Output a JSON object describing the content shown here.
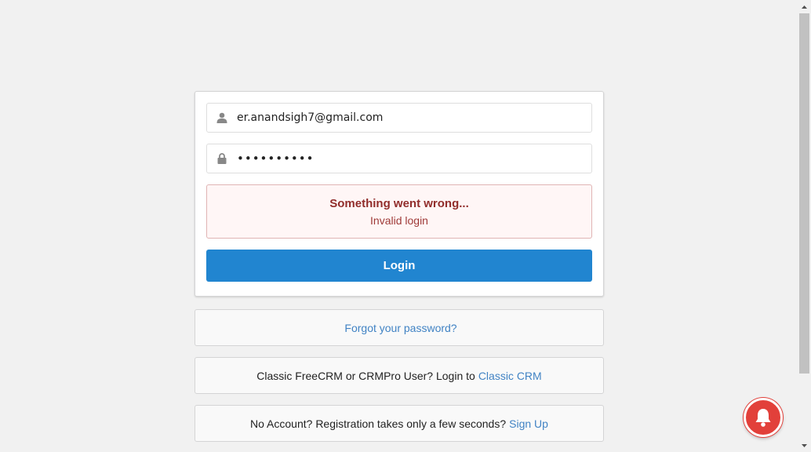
{
  "login_form": {
    "email_value": "er.anandsigh7@gmail.com",
    "password_value": "••••••••••",
    "error_title": "Something went wrong...",
    "error_message": "Invalid login",
    "login_label": "Login"
  },
  "links": {
    "forgot_password": "Forgot your password?",
    "classic_prompt": "Classic FreeCRM or CRMPro User? Login to",
    "classic_link": "Classic CRM",
    "signup_prompt": "No Account? Registration takes only a few seconds?",
    "signup_link": "Sign Up"
  },
  "icons": {
    "user": "user-icon",
    "lock": "lock-icon",
    "notification": "bell-icon"
  },
  "colors": {
    "primary": "#2185d0",
    "link": "#4183c4",
    "error_bg": "#fff6f6",
    "error_text": "#912d2b",
    "bell": "#e2403a"
  }
}
